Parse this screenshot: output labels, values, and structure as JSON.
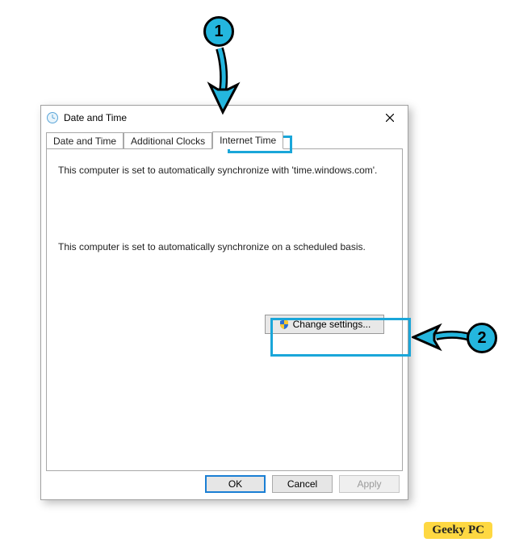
{
  "dialog": {
    "title": "Date and Time",
    "tabs": [
      {
        "label": "Date and Time"
      },
      {
        "label": "Additional Clocks"
      },
      {
        "label": "Internet Time"
      }
    ],
    "active_tab_index": 2,
    "sync_message_1": "This computer is set to automatically synchronize with 'time.windows.com'.",
    "sync_message_2": "This computer is set to automatically synchronize on a scheduled basis.",
    "change_button": "Change settings...",
    "buttons": {
      "ok": "OK",
      "cancel": "Cancel",
      "apply": "Apply"
    }
  },
  "annotations": {
    "step1": "1",
    "step2": "2"
  },
  "watermark": "Geeky PC"
}
